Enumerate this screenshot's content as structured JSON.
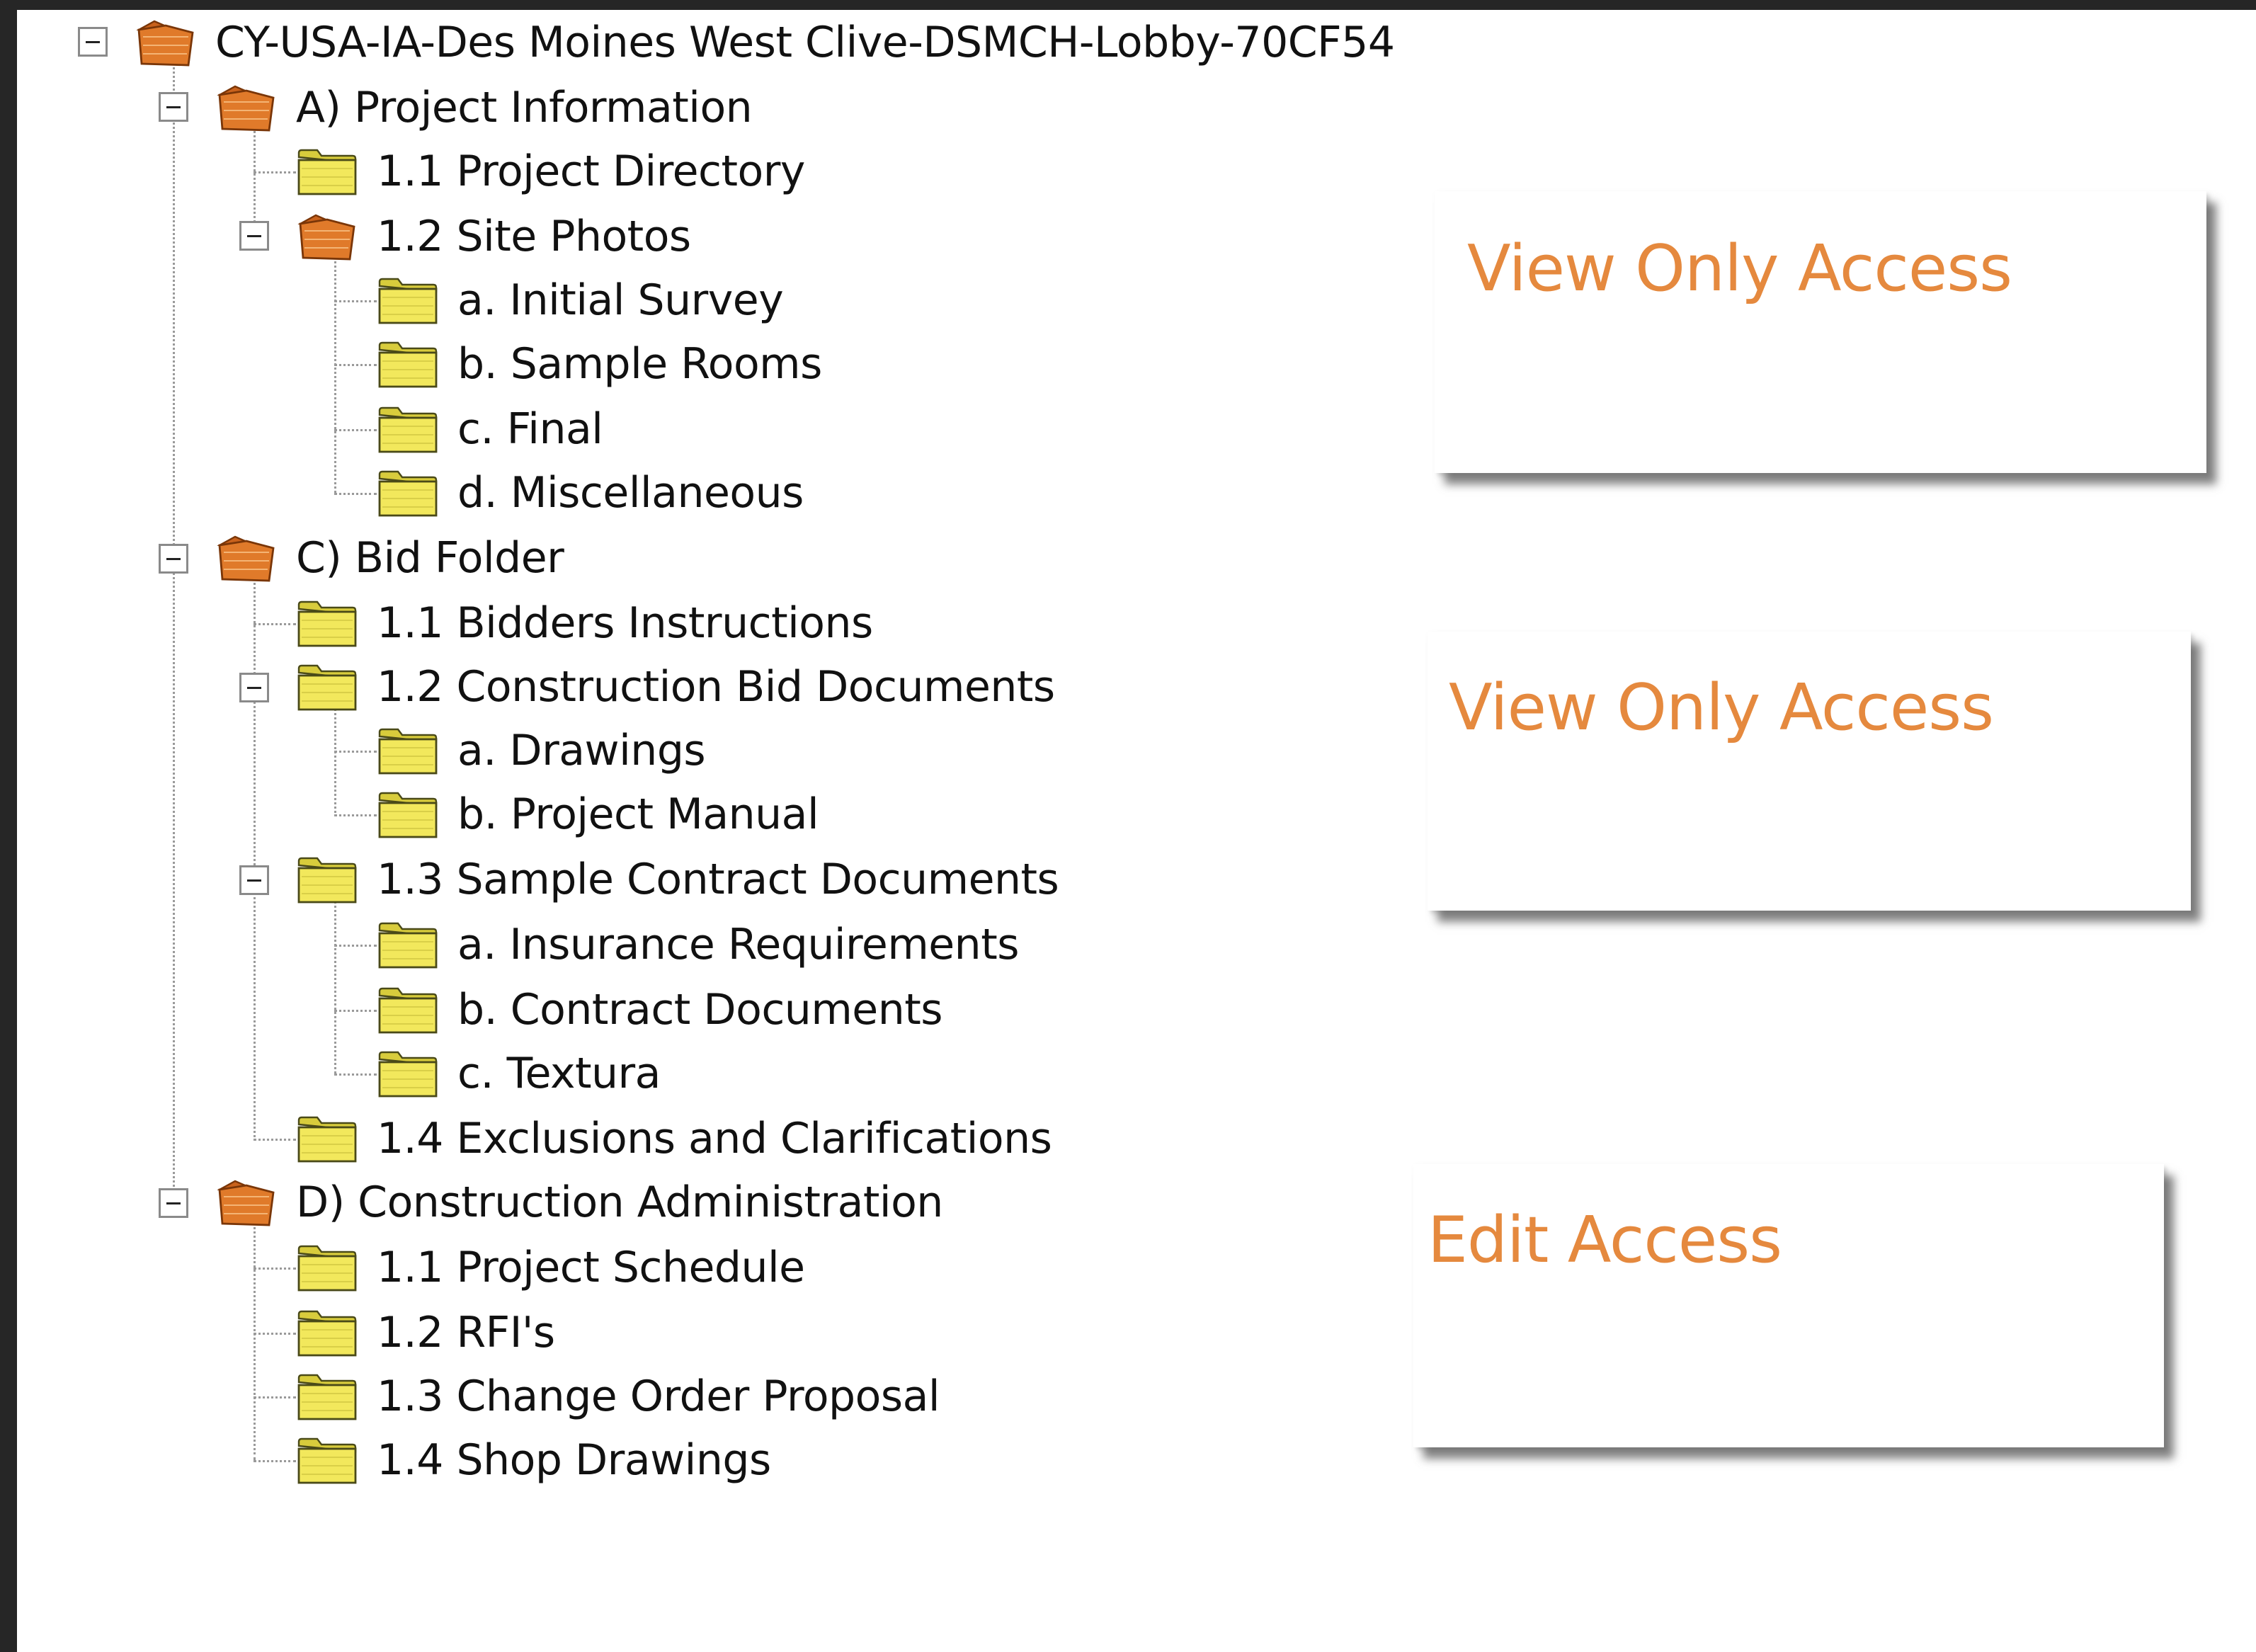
{
  "tree": {
    "root": {
      "label": "CY-USA-IA-Des Moines West Clive-DSMCH-Lobby-70CF54",
      "icon": "open-folder-icon"
    },
    "groups": [
      {
        "label": "A) Project Information",
        "icon": "open-folder-icon",
        "items": [
          {
            "label": "1.1 Project Directory",
            "icon": "folder-icon"
          },
          {
            "label": "1.2 Site Photos",
            "icon": "open-folder-icon",
            "children": [
              "a. Initial Survey",
              "b. Sample Rooms",
              "c. Final",
              "d. Miscellaneous"
            ]
          }
        ]
      },
      {
        "label": "C) Bid Folder",
        "icon": "open-folder-icon",
        "items": [
          {
            "label": "1.1 Bidders Instructions",
            "icon": "folder-icon"
          },
          {
            "label": "1.2 Construction Bid Documents",
            "icon": "folder-icon",
            "children": [
              "a. Drawings",
              "b. Project Manual"
            ]
          },
          {
            "label": "1.3 Sample Contract Documents",
            "icon": "folder-icon",
            "children": [
              "a. Insurance Requirements",
              "b. Contract Documents",
              "c. Textura"
            ]
          },
          {
            "label": "1.4 Exclusions and Clarifications",
            "icon": "folder-icon"
          }
        ]
      },
      {
        "label": "D) Construction Administration",
        "icon": "open-folder-icon",
        "items": [
          {
            "label": "1.1 Project Schedule",
            "icon": "folder-icon"
          },
          {
            "label": "1.2 RFI's",
            "icon": "folder-icon"
          },
          {
            "label": "1.3 Change Order Proposal",
            "icon": "folder-icon"
          },
          {
            "label": "1.4 Shop Drawings",
            "icon": "folder-icon"
          }
        ]
      }
    ]
  },
  "callouts": [
    "View Only Access",
    "View Only Access",
    "Edit Access"
  ],
  "colors": {
    "callout_text": "#e5893e",
    "folder_yellow": "#f2e85c",
    "folder_orange": "#e07a2a",
    "frame": "#262626"
  }
}
